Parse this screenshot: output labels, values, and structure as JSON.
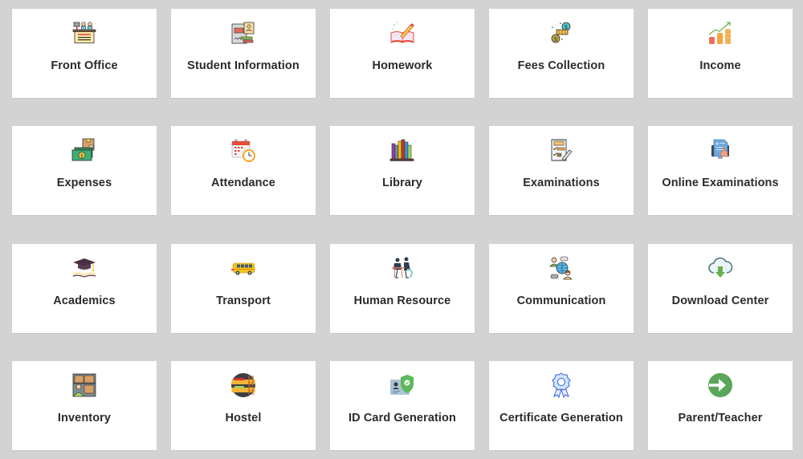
{
  "modules": [
    {
      "label": "Front Office",
      "icon": "front-desk-icon"
    },
    {
      "label": "Student Information",
      "icon": "student-profile-icon"
    },
    {
      "label": "Homework",
      "icon": "book-pencil-icon"
    },
    {
      "label": "Fees Collection",
      "icon": "money-coins-icon"
    },
    {
      "label": "Income",
      "icon": "growth-chart-coins-icon"
    },
    {
      "label": "Expenses",
      "icon": "cash-box-icon"
    },
    {
      "label": "Attendance",
      "icon": "calendar-clock-icon"
    },
    {
      "label": "Library",
      "icon": "books-shelf-icon"
    },
    {
      "label": "Examinations",
      "icon": "exam-checklist-icon"
    },
    {
      "label": "Online Examinations",
      "icon": "online-exam-icon"
    },
    {
      "label": "Academics",
      "icon": "graduation-cap-icon"
    },
    {
      "label": "Transport",
      "icon": "school-bus-icon"
    },
    {
      "label": "Human Resource",
      "icon": "people-meeting-icon"
    },
    {
      "label": "Communication",
      "icon": "global-chat-icon"
    },
    {
      "label": "Download Center",
      "icon": "cloud-download-icon"
    },
    {
      "label": "Inventory",
      "icon": "warehouse-boxes-icon"
    },
    {
      "label": "Hostel",
      "icon": "bunk-bed-icon"
    },
    {
      "label": "ID Card Generation",
      "icon": "id-card-shield-icon"
    },
    {
      "label": "Certificate Generation",
      "icon": "award-ribbon-icon"
    },
    {
      "label": "Parent/Teacher",
      "icon": "arrow-circle-right-icon"
    }
  ],
  "colors": {
    "background": "#d3d3d3",
    "tile": "#ffffff",
    "label": "#2b2b2b"
  }
}
